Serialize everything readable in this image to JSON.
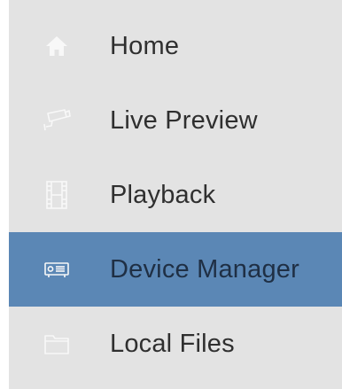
{
  "menu": {
    "items": [
      {
        "label": "Home",
        "icon": "home-icon",
        "active": false
      },
      {
        "label": "Live Preview",
        "icon": "camera-icon",
        "active": false
      },
      {
        "label": "Playback",
        "icon": "film-icon",
        "active": false
      },
      {
        "label": "Device Manager",
        "icon": "device-icon",
        "active": true
      },
      {
        "label": "Local Files",
        "icon": "folder-icon",
        "active": false
      }
    ]
  },
  "colors": {
    "sidebar_bg": "#e3e3e3",
    "active_bg": "#5b87b5",
    "text": "#2f2f2f",
    "icon": "#f8f8f8"
  }
}
